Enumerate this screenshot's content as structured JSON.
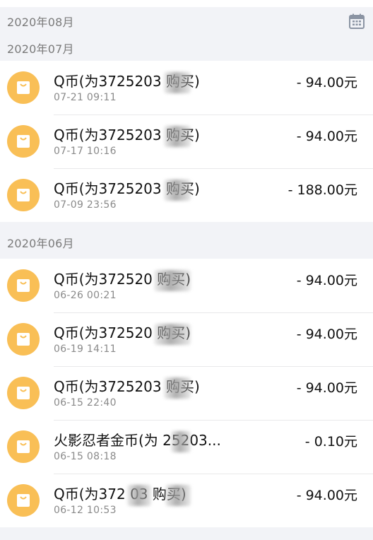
{
  "months": [
    {
      "label": "2020年08月",
      "items": []
    },
    {
      "label": "2020年07月",
      "items": [
        {
          "title": "Q币(为3725203   购买)",
          "time": "07-21 09:11",
          "amount": "- 94.00元"
        },
        {
          "title": "Q币(为3725203   购买)",
          "time": "07-17 10:16",
          "amount": "- 94.00元"
        },
        {
          "title": "Q币(为3725203   购买)",
          "time": "07-09 23:56",
          "amount": "- 188.00元"
        }
      ]
    },
    {
      "label": "2020年06月",
      "items": [
        {
          "title": "Q币(为372520    购买)",
          "time": "06-26 00:21",
          "amount": "- 94.00元"
        },
        {
          "title": "Q币(为372520    购买)",
          "time": "06-19 14:11",
          "amount": "- 94.00元"
        },
        {
          "title": "Q币(为3725203   购买)",
          "time": "06-15 22:40",
          "amount": "- 94.00元"
        },
        {
          "title": "火影忍者金币(为  25203...",
          "time": "06-15 08:18",
          "amount": "- 0.10元"
        },
        {
          "title": "Q币(为372   03   购买)",
          "time": "06-12 10:53",
          "amount": "- 94.00元"
        }
      ]
    }
  ],
  "icons": {
    "calendar": "calendar-icon",
    "item": "shopping-bag-icon"
  },
  "colors": {
    "accent": "#f9bf56",
    "background": "#f2f3f7",
    "header_text": "#7a7a7a"
  }
}
